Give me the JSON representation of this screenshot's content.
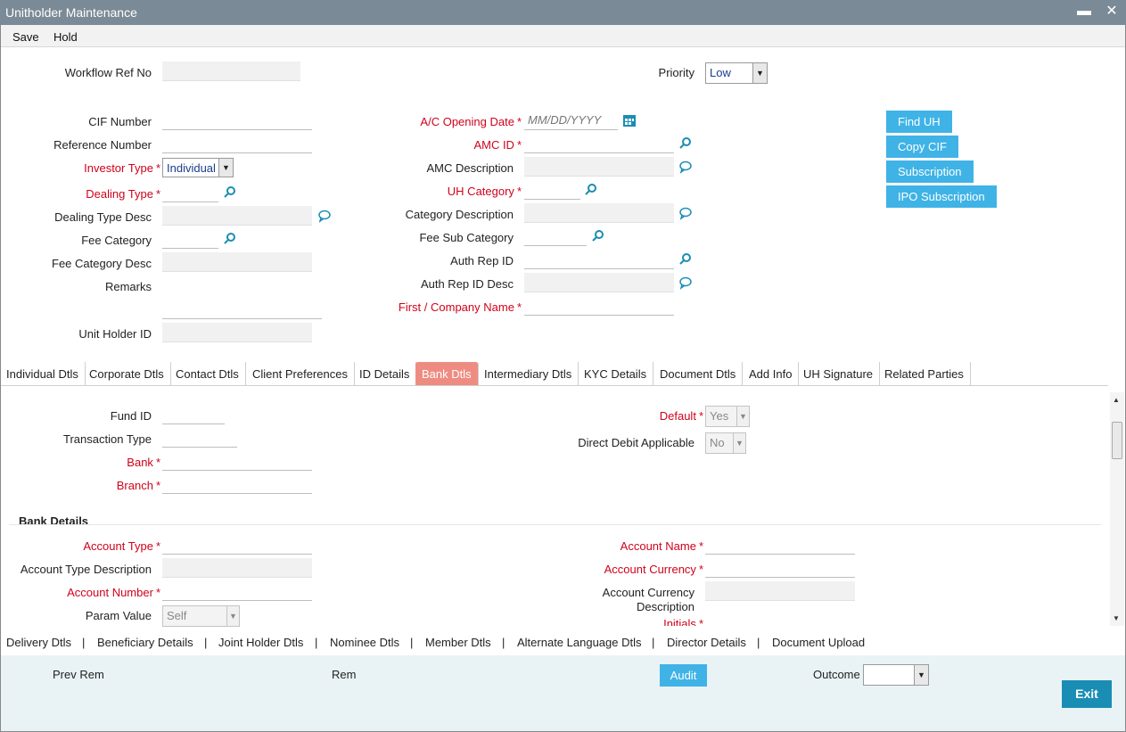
{
  "window": {
    "title": "Unitholder Maintenance",
    "minimize": "▬",
    "close": "✕"
  },
  "menu": {
    "save": "Save",
    "hold": "Hold"
  },
  "header": {
    "workflow_ref_label": "Workflow Ref No",
    "priority_label": "Priority",
    "priority_value": "Low"
  },
  "left": {
    "cif_label": "CIF Number",
    "ref_label": "Reference Number",
    "investor_type_label": "Investor Type",
    "investor_type_value": "Individual",
    "dealing_type_label": "Dealing Type",
    "dealing_type_desc_label": "Dealing Type Desc",
    "fee_category_label": "Fee Category",
    "fee_category_desc_label": "Fee Category Desc",
    "remarks_label": "Remarks",
    "unit_holder_id_label": "Unit Holder ID"
  },
  "middle": {
    "ac_opening_label": "A/C Opening Date",
    "ac_opening_placeholder": "MM/DD/YYYY",
    "amc_id_label": "AMC ID",
    "amc_desc_label": "AMC Description",
    "uh_category_label": "UH Category",
    "category_desc_label": "Category Description",
    "fee_sub_category_label": "Fee Sub Category",
    "auth_rep_id_label": "Auth Rep ID",
    "auth_rep_desc_label": "Auth Rep ID Desc",
    "first_company_label": "First / Company Name"
  },
  "actions": {
    "find_uh": "Find UH",
    "copy_cif": "Copy CIF",
    "subscription": "Subscription",
    "ipo_subscription": "IPO Subscription"
  },
  "tabs": [
    "Individual Dtls",
    "Corporate Dtls",
    "Contact Dtls",
    "Client Preferences",
    "ID Details",
    "Bank Dtls",
    "Intermediary Dtls",
    "KYC Details",
    "Document Dtls",
    "Add Info",
    "UH Signature",
    "Related Parties"
  ],
  "active_tab": "Bank Dtls",
  "bank_tab": {
    "fund_id_label": "Fund ID",
    "transaction_type_label": "Transaction Type",
    "bank_label": "Bank",
    "branch_label": "Branch",
    "default_label": "Default",
    "default_value": "Yes",
    "direct_debit_label": "Direct Debit Applicable",
    "direct_debit_value": "No",
    "bank_details_title": "Bank Details",
    "account_type_label": "Account Type",
    "account_type_desc_label": "Account Type Description",
    "account_number_label": "Account Number",
    "param_value_label": "Param Value",
    "param_value_value": "Self",
    "account_name_label": "Account Name",
    "account_currency_label": "Account Currency",
    "account_currency_desc_label_1": "Account Currency",
    "account_currency_desc_label_2": "Description",
    "initials_label": "Initials"
  },
  "bottom_links": [
    "Delivery Dtls",
    "Beneficiary Details",
    "Joint Holder Dtls",
    "Nominee Dtls",
    "Member Dtls",
    "Alternate Language Dtls",
    "Director Details",
    "Document Upload"
  ],
  "footer": {
    "prev_rem": "Prev Rem",
    "rem": "Rem",
    "audit": "Audit",
    "outcome": "Outcome",
    "outcome_value": "",
    "exit": "Exit"
  },
  "colors": {
    "title_bar": "#7a8a96",
    "required": "#d0021b",
    "button_blue": "#3fb3e6",
    "active_tab": "#ef8c82",
    "exit": "#1a8db4"
  }
}
